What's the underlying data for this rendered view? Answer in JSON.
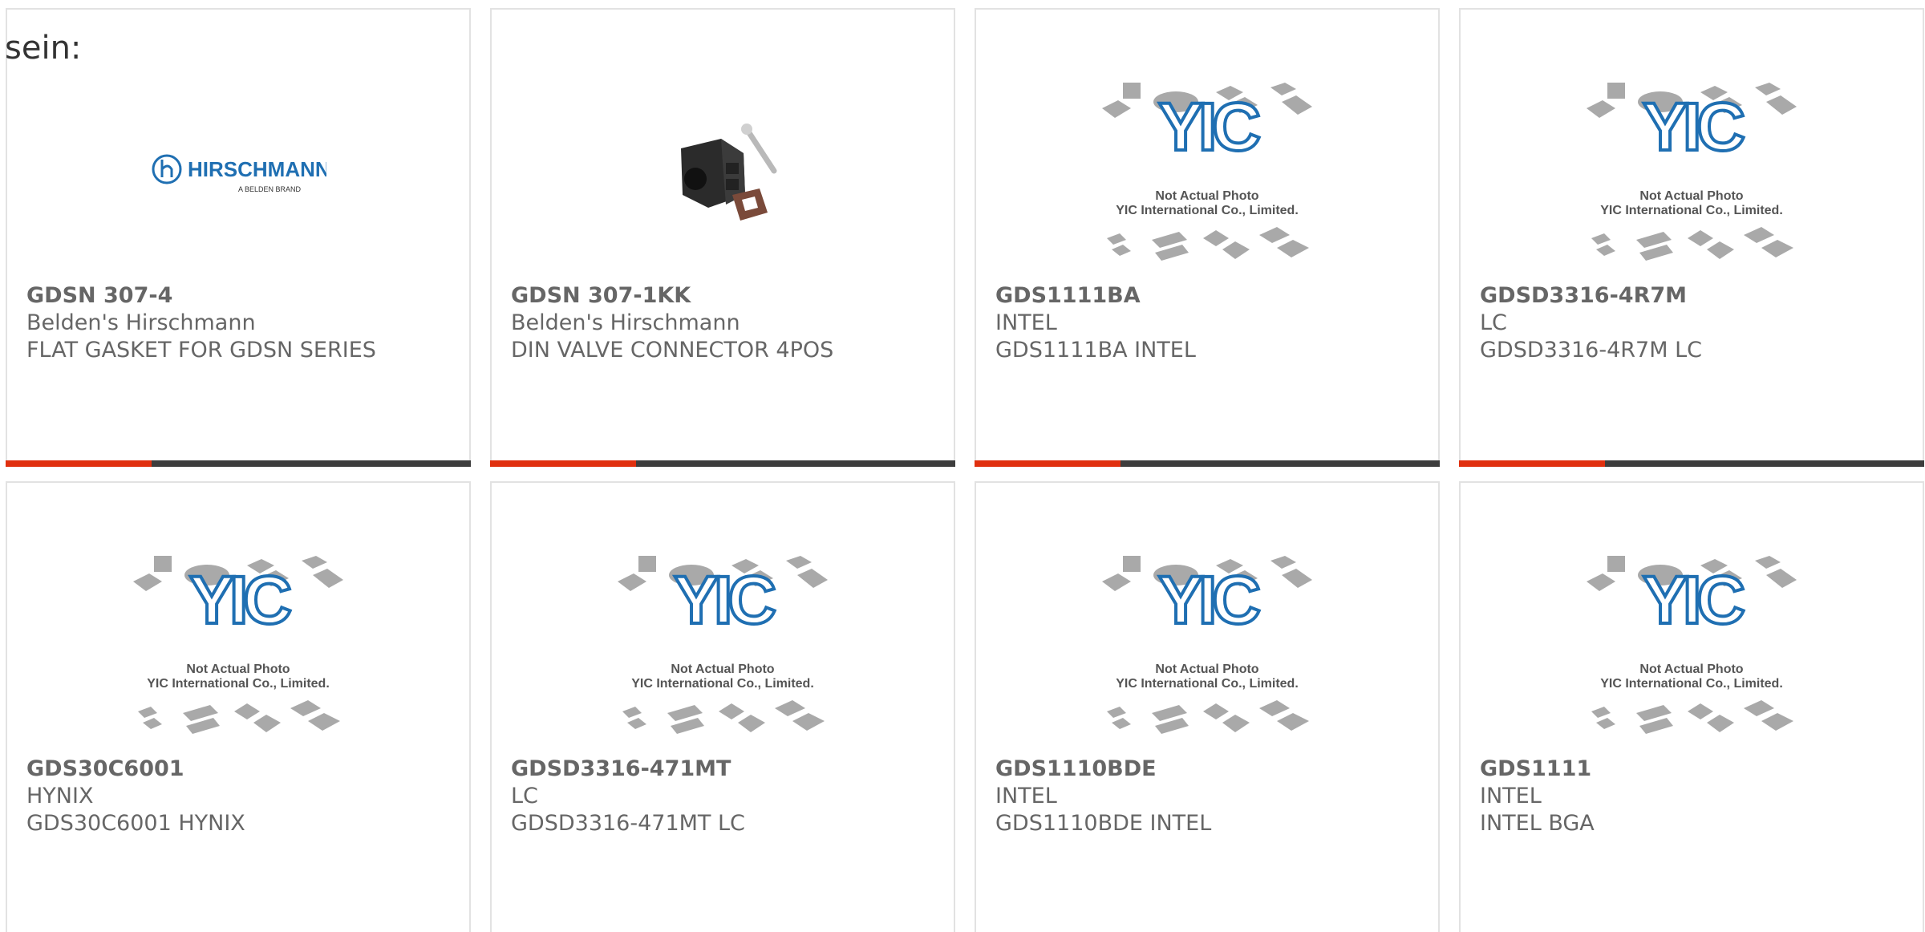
{
  "lead_text": "sein:",
  "colors": {
    "accent": "#e0300f",
    "bar": "#3d3d3d",
    "text": "#666666",
    "card_border": "#e2e2e2",
    "logo_blue": "#1f6fb2"
  },
  "products": [
    {
      "part": "GDSN 307-4",
      "brand": "Belden's Hirschmann",
      "desc": "FLAT GASKET FOR GDSN SERIES",
      "image": "hirschmann-logo",
      "logo_name": "HIRSCHMANN",
      "logo_tagline": "A BELDEN BRAND"
    },
    {
      "part": "GDSN 307-1KK",
      "brand": "Belden's Hirschmann",
      "desc": "DIN VALVE CONNECTOR 4POS",
      "image": "connector-photo"
    },
    {
      "part": "GDS1111BA",
      "brand": "INTEL",
      "desc": "GDS1111BA INTEL",
      "image": "placeholder-photo",
      "ph1": "Not Actual Photo",
      "ph2": "YIC International Co., Limited."
    },
    {
      "part": "GDSD3316-4R7M",
      "brand": "LC",
      "desc": "GDSD3316-4R7M LC",
      "image": "placeholder-photo",
      "ph1": "Not Actual Photo",
      "ph2": "YIC International Co., Limited."
    },
    {
      "part": "GDS30C6001",
      "brand": "HYNIX",
      "desc": "GDS30C6001 HYNIX",
      "image": "placeholder-photo",
      "ph1": "Not Actual Photo",
      "ph2": "YIC International Co., Limited."
    },
    {
      "part": "GDSD3316-471MT",
      "brand": "LC",
      "desc": "GDSD3316-471MT LC",
      "image": "placeholder-photo",
      "ph1": "Not Actual Photo",
      "ph2": "YIC International Co., Limited."
    },
    {
      "part": "GDS1110BDE",
      "brand": "INTEL",
      "desc": "GDS1110BDE INTEL",
      "image": "placeholder-photo",
      "ph1": "Not Actual Photo",
      "ph2": "YIC International Co., Limited."
    },
    {
      "part": "GDS1111",
      "brand": "INTEL",
      "desc": "INTEL BGA",
      "image": "placeholder-photo",
      "ph1": "Not Actual Photo",
      "ph2": "YIC International Co., Limited."
    }
  ]
}
